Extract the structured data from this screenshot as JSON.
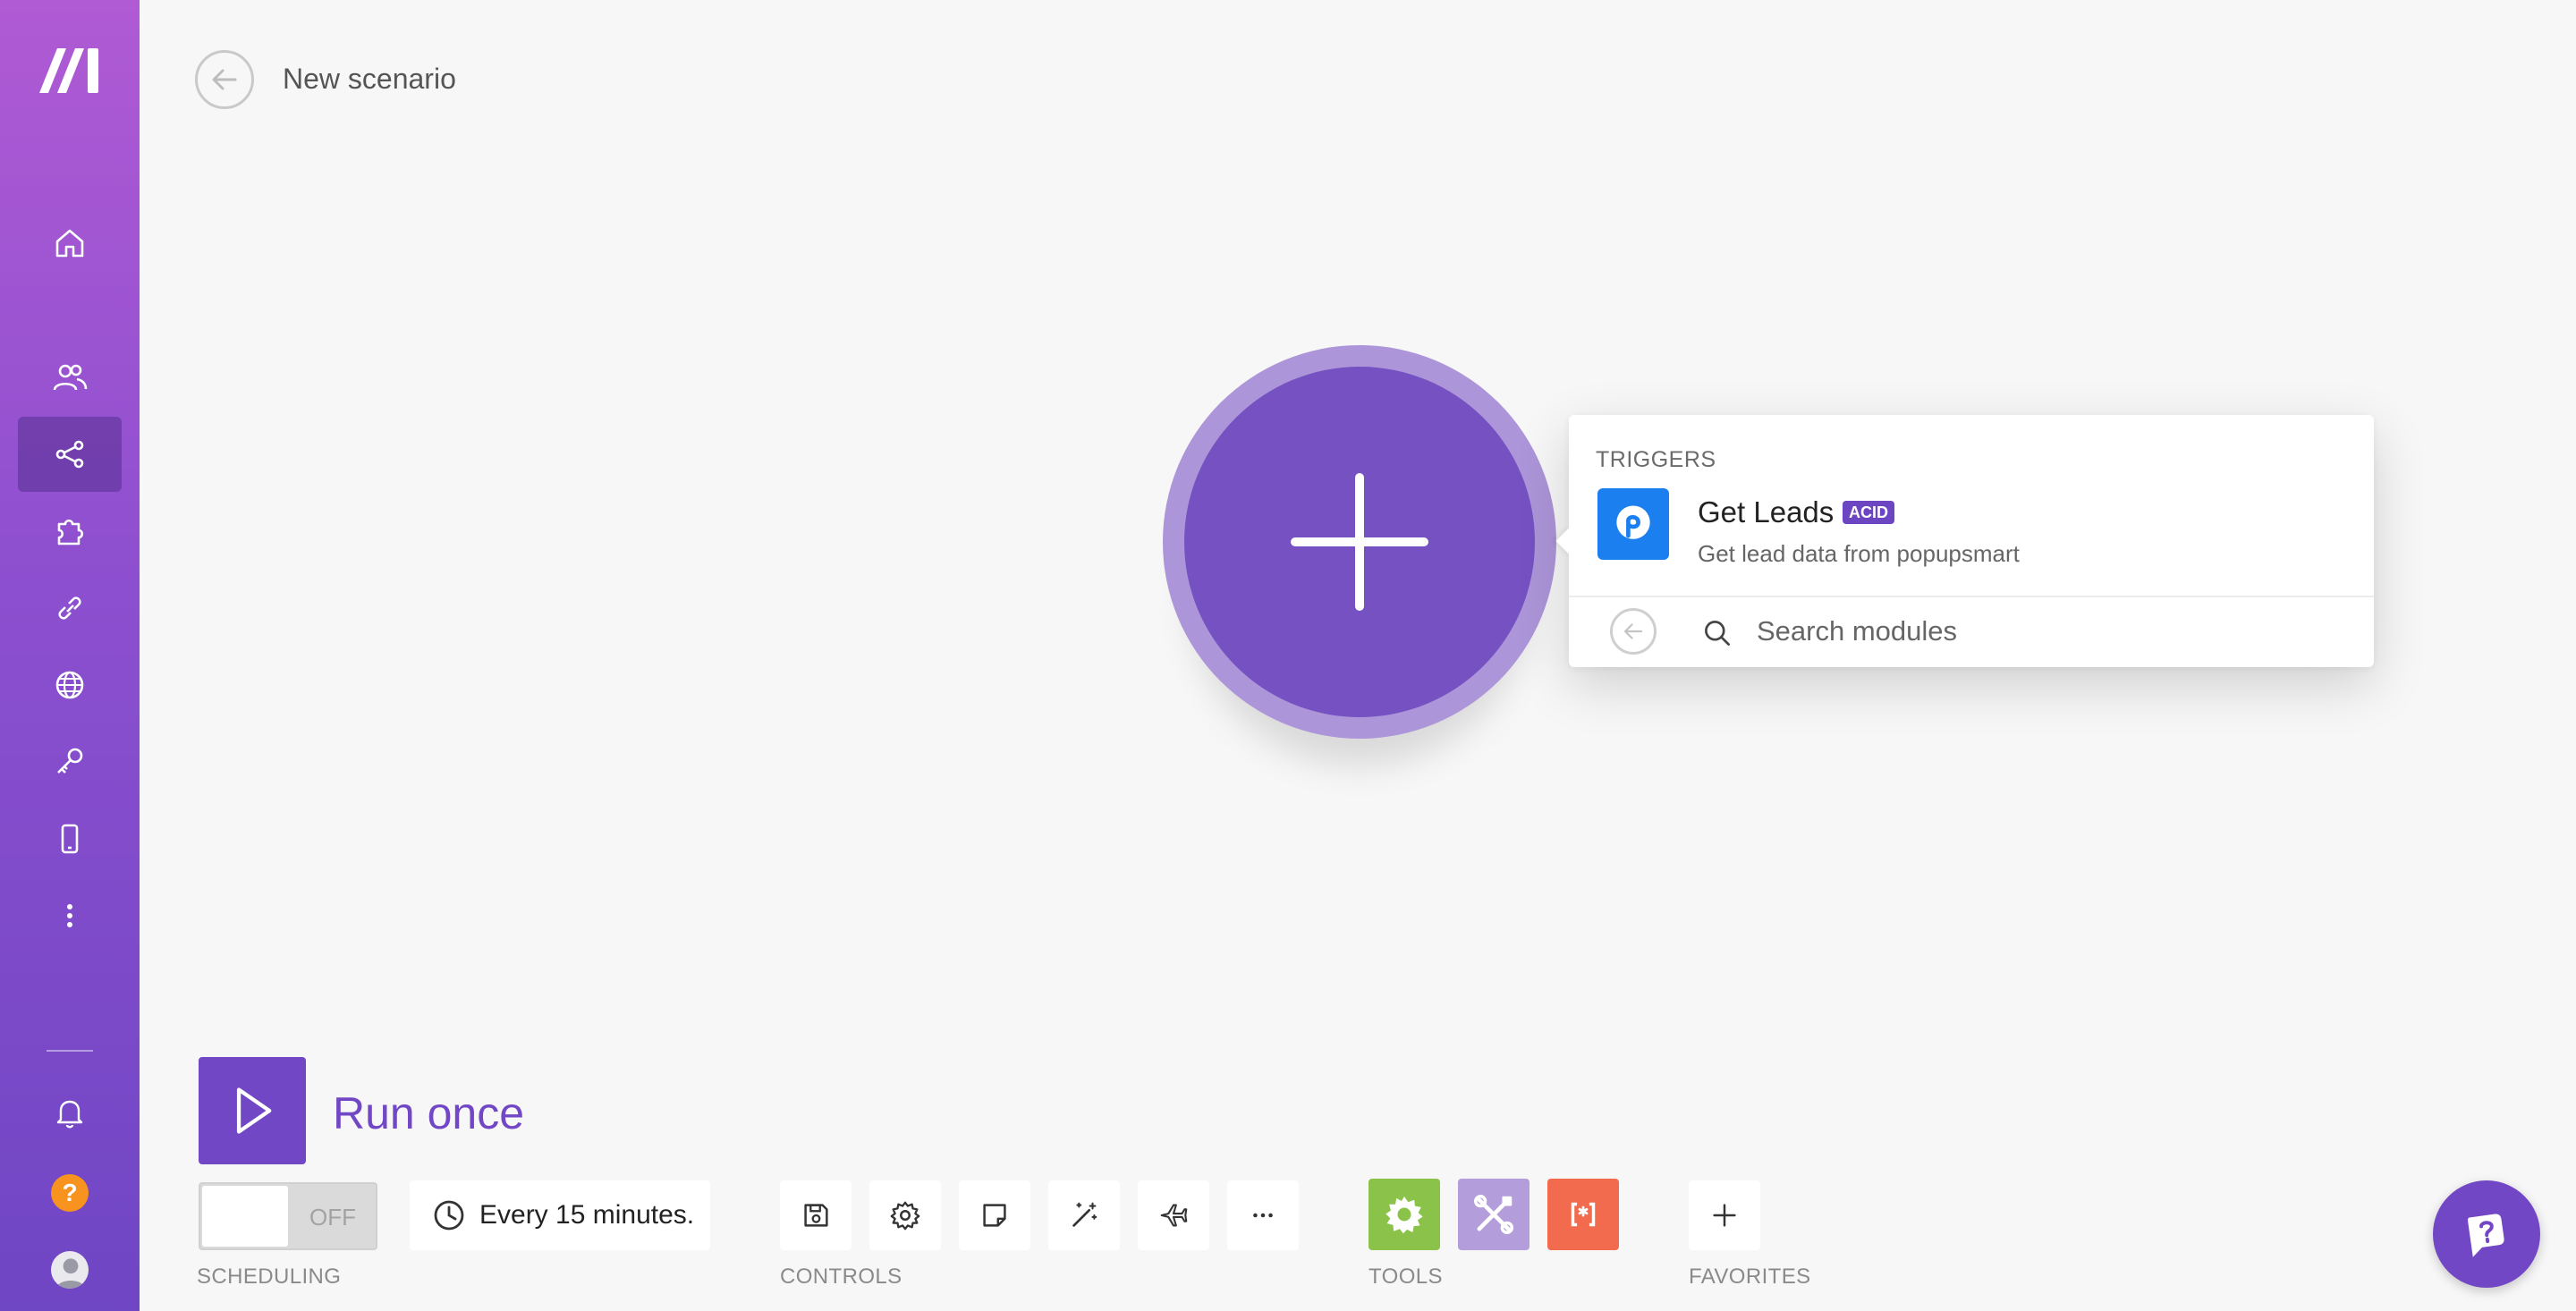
{
  "header": {
    "title": "New scenario"
  },
  "sidebar": {
    "items": [
      {
        "name": "home",
        "icon": "home-icon"
      },
      {
        "name": "team",
        "icon": "users-icon"
      },
      {
        "name": "scenarios",
        "icon": "share-icon",
        "active": true
      },
      {
        "name": "templates",
        "icon": "puzzle-icon"
      },
      {
        "name": "connections",
        "icon": "link-icon"
      },
      {
        "name": "webhooks",
        "icon": "globe-icon"
      },
      {
        "name": "keys",
        "icon": "key-icon"
      },
      {
        "name": "devices",
        "icon": "mobile-icon"
      },
      {
        "name": "more",
        "icon": "more-vertical-icon"
      }
    ],
    "bottom": {
      "notifications_icon": "bell-icon",
      "help_badge": "?",
      "avatar_icon": "user-avatar"
    },
    "brand_gradient": [
      "#b05ad4",
      "#6f46c4"
    ]
  },
  "canvas": {
    "add_module_icon": "plus-icon",
    "module_color": "#7551c2"
  },
  "popup": {
    "section": "TRIGGERS",
    "trigger": {
      "name": "Get Leads",
      "badge": "ACID",
      "description": "Get lead data from popupsmart",
      "app_icon": "popupsmart-icon",
      "app_color": "#1c7ff0"
    },
    "search_placeholder": "Search modules"
  },
  "toolbar": {
    "run_label": "Run once",
    "toggle_label": "OFF",
    "schedule": "Every 15 minutes.",
    "labels": {
      "scheduling": "SCHEDULING",
      "controls": "CONTROLS",
      "tools": "TOOLS",
      "favorites": "FAVORITES"
    },
    "controls": [
      "save-icon",
      "settings-icon",
      "notes-icon",
      "magic-wand-icon",
      "airplane-icon",
      "more-icon"
    ],
    "tools": [
      {
        "icon": "gear-icon",
        "color": "#8bc34a"
      },
      {
        "icon": "tools-icon",
        "color": "#b39ddb"
      },
      {
        "icon": "text-parser-icon",
        "color": "#f26b4f"
      }
    ],
    "accent": "#7247c5"
  },
  "chat": {
    "icon": "chat-icon"
  }
}
